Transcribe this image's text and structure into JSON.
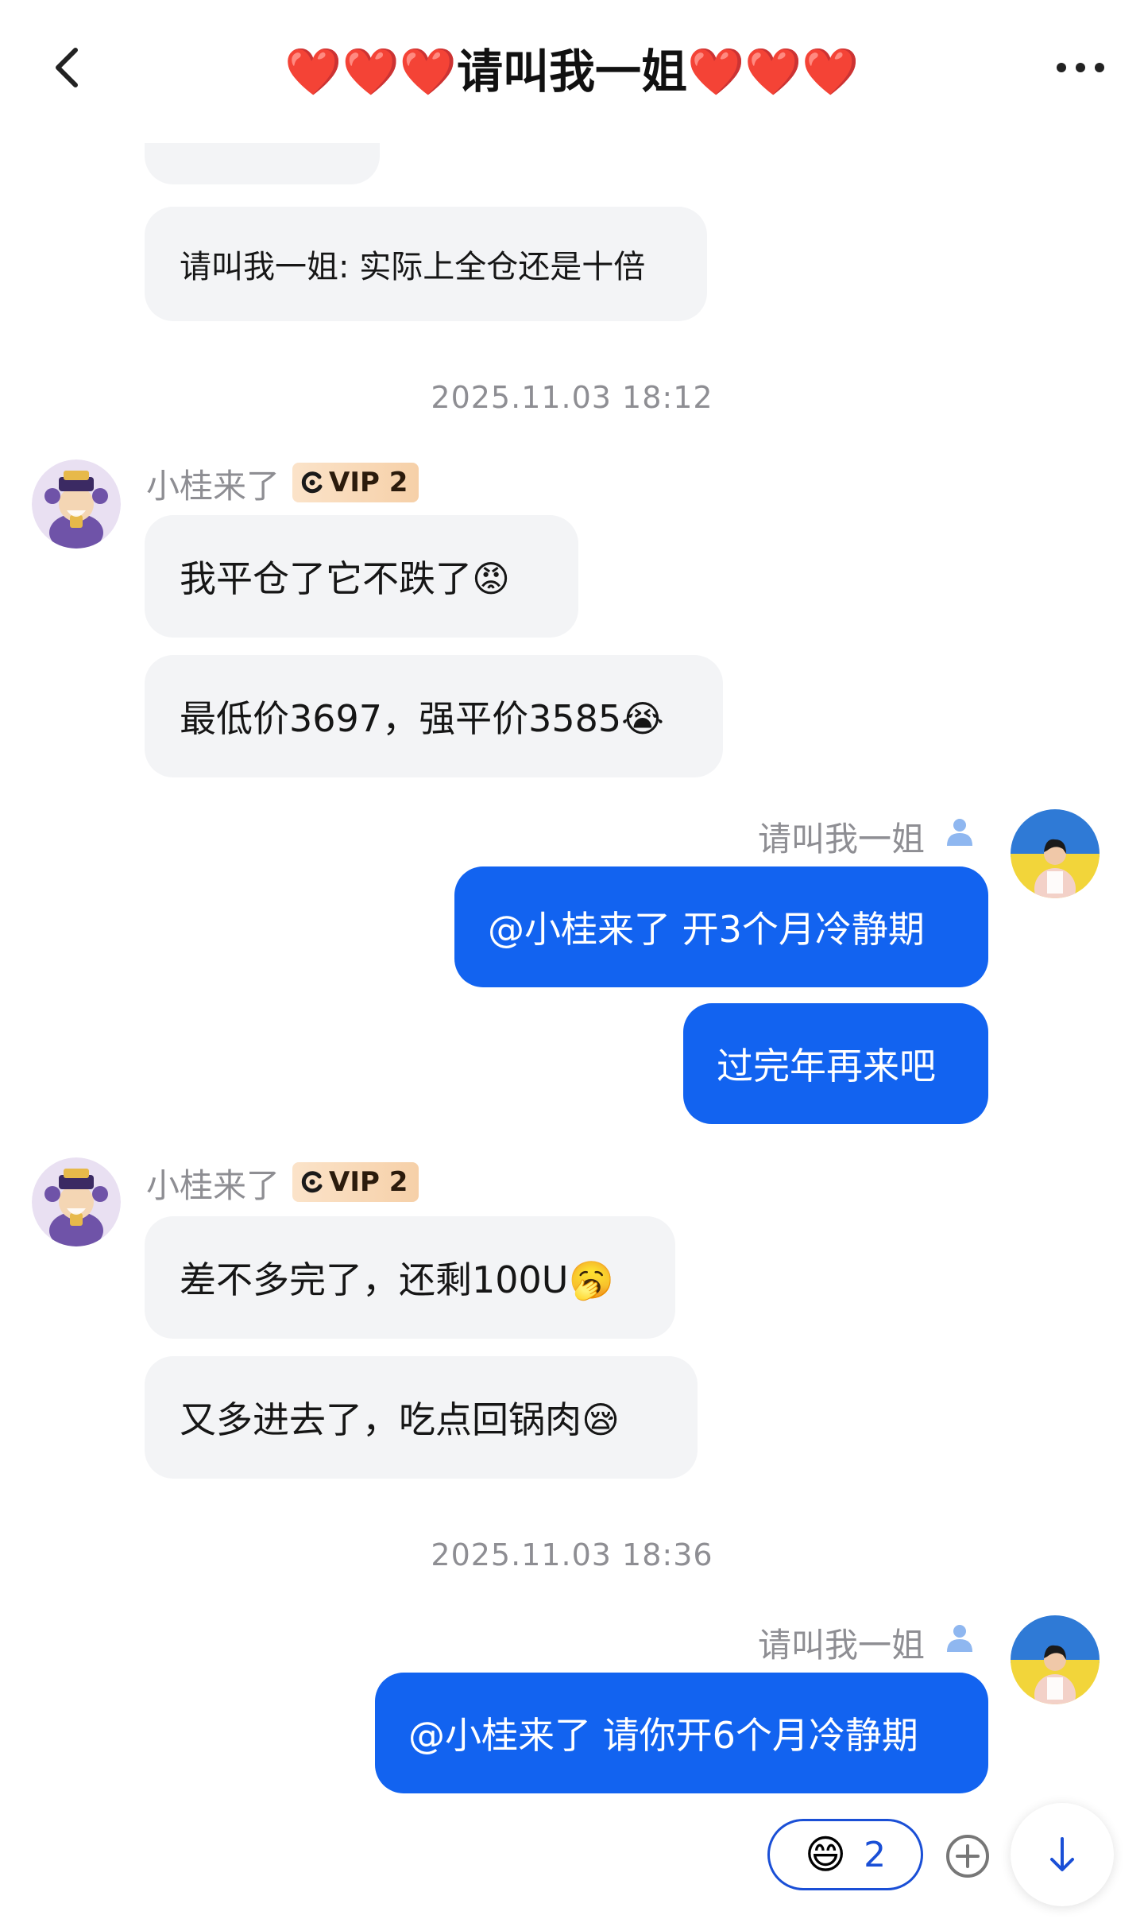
{
  "header": {
    "title": "❤️❤️❤️请叫我一姐❤️❤️❤️",
    "back_icon": "chevron-left-icon",
    "more_icon": "more-dots-icon"
  },
  "messages": {
    "partial_top": {
      "text": ""
    },
    "quote_reply": {
      "text": "请叫我一姐: 实际上全仓还是十倍"
    },
    "timestamp_1": "2025.11.03 18:12",
    "group_a": {
      "sender": "小桂来了",
      "vip": "VIP 2",
      "msg1": "我平仓了它不跌了😡",
      "msg2": "最低价3697，强平价3585😭"
    },
    "group_b": {
      "sender": "请叫我一姐",
      "msg1": "@小桂来了 开3个月冷静期",
      "msg2": "过完年再来吧"
    },
    "group_c": {
      "sender": "小桂来了",
      "vip": "VIP 2",
      "msg1": "差不多完了，还剩100U🥱",
      "msg2": "又多进去了，吃点回锅肉😪"
    },
    "timestamp_2": "2025.11.03 18:36",
    "group_d": {
      "sender": "请叫我一姐",
      "msg1": "@小桂来了 请你开6个月冷静期"
    }
  },
  "reactions": {
    "emoji": "😄",
    "count": "2",
    "add_icon": "add-reaction-icon",
    "scroll_icon": "arrow-down-icon"
  },
  "colors": {
    "outgoing_bubble": "#1263f0",
    "incoming_bubble": "#f3f4f6",
    "vip_badge": "#f6d0a8",
    "accent": "#1a4fd6"
  }
}
